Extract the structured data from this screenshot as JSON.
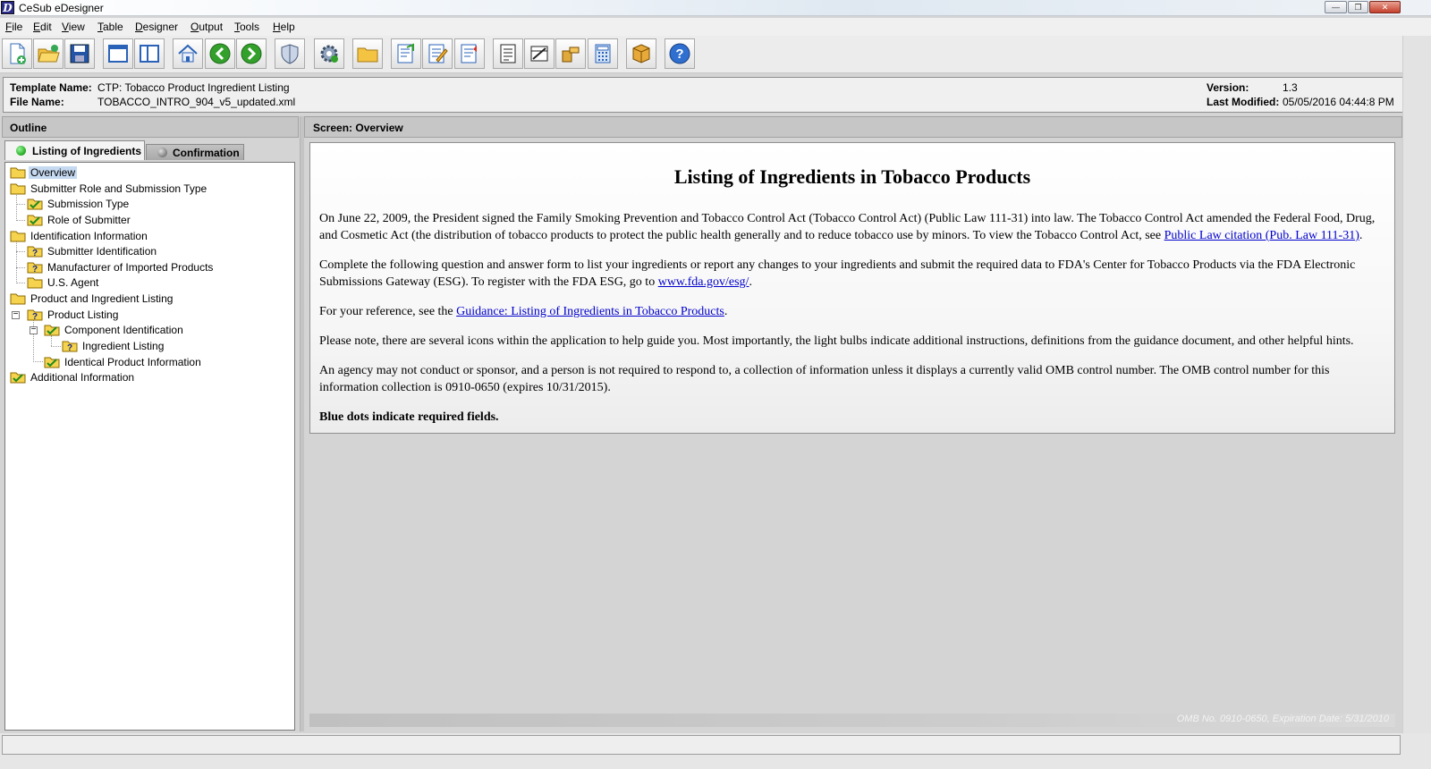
{
  "window": {
    "title": "CeSub eDesigner",
    "icon_letter": "D"
  },
  "menu": [
    "File",
    "Edit",
    "View",
    "Table",
    "Designer",
    "Output",
    "Tools",
    "Help"
  ],
  "info": {
    "template_label": "Template Name:",
    "template_value": "CTP: Tobacco Product Ingredient Listing",
    "file_label": "File Name:",
    "file_value": "TOBACCO_INTRO_904_v5_updated.xml",
    "version_label": "Version:",
    "version_value": "1.3",
    "modified_label": "Last Modified:",
    "modified_value": "05/05/2016 04:44:8 PM"
  },
  "outline": {
    "header": "Outline",
    "tabs": [
      {
        "label": "Listing of Ingredients",
        "status_color": "#2fb52f",
        "active": true
      },
      {
        "label": "Confirmation",
        "status_color": "#8a8a8a",
        "active": false
      }
    ],
    "tree": [
      {
        "label": "Overview",
        "icon": "folder-icon",
        "selected": true
      },
      {
        "label": "Submitter Role and Submission Type",
        "icon": "folder-icon"
      },
      {
        "label": "Submission Type",
        "icon": "check-folder-icon"
      },
      {
        "label": "Role of Submitter",
        "icon": "check-folder-icon"
      },
      {
        "label": "Identification Information",
        "icon": "folder-icon"
      },
      {
        "label": "Submitter Identification",
        "icon": "question-folder-icon"
      },
      {
        "label": "Manufacturer of Imported Products",
        "icon": "question-folder-icon"
      },
      {
        "label": "U.S. Agent",
        "icon": "folder-icon"
      },
      {
        "label": "Product and Ingredient Listing",
        "icon": "folder-icon"
      },
      {
        "label": "Product Listing",
        "icon": "question-folder-icon"
      },
      {
        "label": "Component Identification",
        "icon": "check-folder-icon"
      },
      {
        "label": "Ingredient Listing",
        "icon": "question-folder-icon"
      },
      {
        "label": "Identical Product Information",
        "icon": "check-folder-icon"
      },
      {
        "label": "Additional Information",
        "icon": "check-folder-icon"
      }
    ]
  },
  "screen": {
    "header": "Screen: Overview",
    "title": "Listing of Ingredients in Tobacco Products",
    "p1_text": "On June 22, 2009, the President signed the Family Smoking Prevention and Tobacco Control Act (Tobacco Control Act) (Public Law 111-31) into law. The Tobacco Control Act amended the Federal Food, Drug, and Cosmetic Act (the distribution of tobacco products to protect the public health generally and to reduce tobacco use by minors. To view the Tobacco Control Act, see ",
    "p1_link": "Public Law citation (Pub. Law 111-31)",
    "p1_end": ".",
    "p2_text": "Complete the following question and answer form to list your ingredients or report any changes to your ingredients and submit the required data to FDA's Center for Tobacco Products via the FDA Electronic Submissions Gateway (ESG). To register with the FDA ESG, go to ",
    "p2_link": "www.fda.gov/esg/",
    "p2_end": ".",
    "p3_text": "For your reference, see the ",
    "p3_link": "Guidance: Listing of Ingredients in Tobacco Products",
    "p3_end": ".",
    "p4_text": "Please note, there are several icons within the application to help guide you. Most importantly, the light bulbs indicate additional instructions, definitions from the guidance document, and other helpful hints.",
    "p5_text": "An agency may not conduct or sponsor, and a person is not required to respond to, a collection of information unless it displays a currently valid OMB control number. The OMB control number for this information collection is 0910-0650 (expires 10/31/2015).",
    "p6_text": "Blue dots indicate required fields.",
    "omb_footer": "OMB No. 0910-0650, Expiration Date: 5/31/2010"
  },
  "colors": {
    "selection": "#c5d9f1",
    "link": "#0000cc",
    "folder": "#f5d34e"
  }
}
